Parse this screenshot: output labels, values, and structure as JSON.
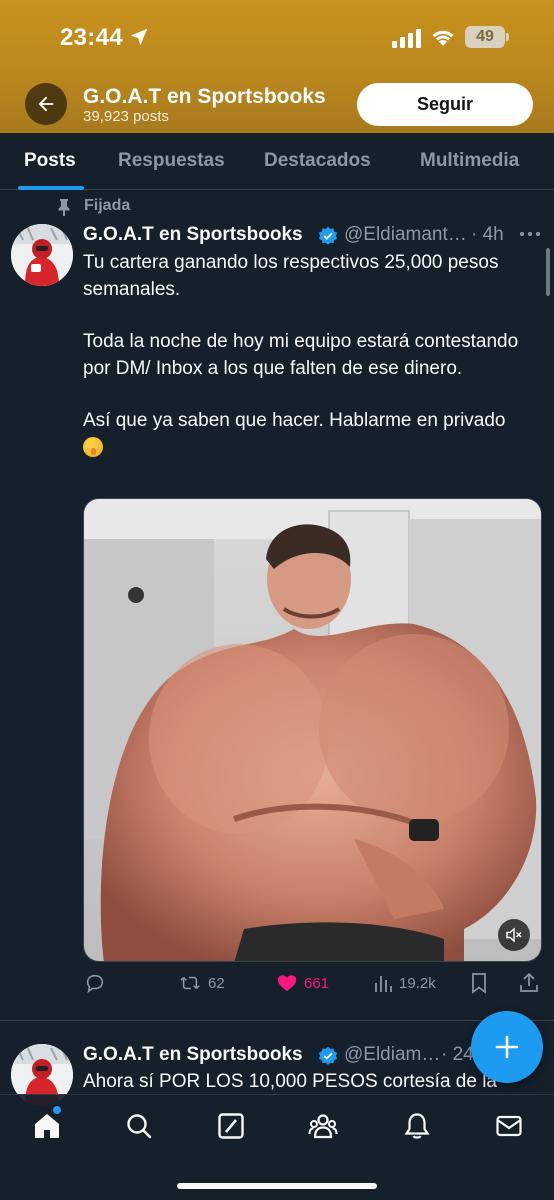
{
  "status_bar": {
    "time": "23:44",
    "battery": "49"
  },
  "header": {
    "title": "G.O.A.T en Sportsbooks",
    "post_count": "39,923 posts",
    "follow_label": "Seguir"
  },
  "tabs": [
    {
      "label": "Posts",
      "active": true
    },
    {
      "label": "Respuestas",
      "active": false
    },
    {
      "label": "Destacados",
      "active": false
    },
    {
      "label": "Multimedia",
      "active": false
    }
  ],
  "pinned_post": {
    "pinned_label": "Fijada",
    "author": "G.O.A.T en Sportsbooks",
    "handle": "@Eldiamant…",
    "time": "· 4h",
    "paragraphs": [
      "Tu cartera ganando los respectivos 25,000 pesos semanales.",
      "Toda la noche de hoy mi equipo estará contestando por DM/ Inbox a los que falten de ese dinero.",
      "Así que ya saben que hacer. Hablarme en privado"
    ],
    "stats": {
      "retweets": "62",
      "likes": "661",
      "views": "19.2k"
    }
  },
  "second_post": {
    "author": "G.O.A.T en Sportsbooks",
    "handle": "@Eldiam…",
    "time": "· 24",
    "text": "Ahora sí POR LOS 10,000 PESOS cortesía de la"
  },
  "icons": {
    "back": "arrow-left-icon",
    "verified": "verified-badge-icon",
    "compose": "plus-icon",
    "nav": [
      "home-icon",
      "search-icon",
      "grok-icon",
      "communities-icon",
      "notifications-icon",
      "messages-icon"
    ]
  },
  "colors": {
    "accent": "#1d9bf0",
    "like": "#f91880",
    "header": "#b9861f",
    "background": "#15202b"
  }
}
